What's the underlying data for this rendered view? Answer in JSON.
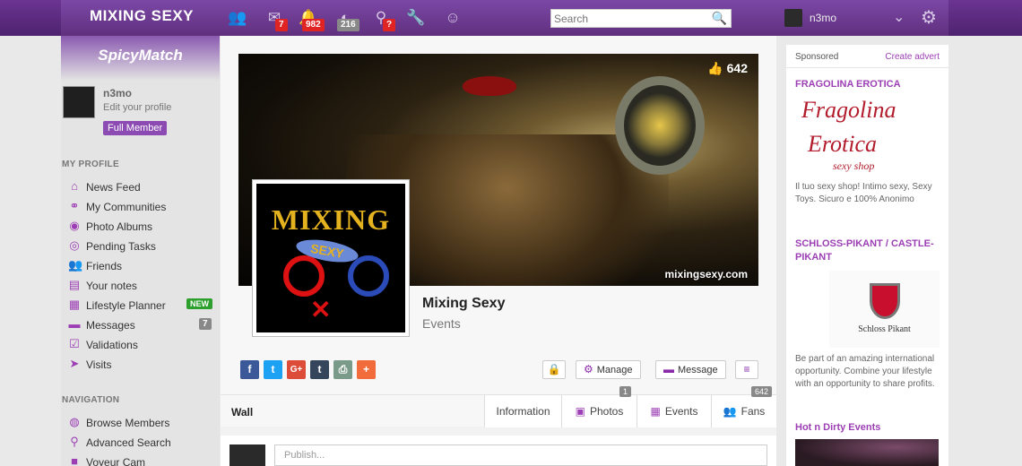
{
  "topbar": {
    "logo": "MIXING SEXY",
    "badges": {
      "messages": "7",
      "notifications": "982",
      "visits": "216",
      "places": "?"
    },
    "search_placeholder": "Search",
    "username": "n3mo"
  },
  "sidebar": {
    "banner": "SpicyMatch",
    "profile": {
      "name": "n3mo",
      "edit": "Edit your profile",
      "membership": "Full Member"
    },
    "my_profile_title": "MY PROFILE",
    "my_profile_items": [
      {
        "label": "News Feed",
        "icon": "home-icon"
      },
      {
        "label": "My Communities",
        "icon": "communities-icon"
      },
      {
        "label": "Photo Albums",
        "icon": "camera-icon"
      },
      {
        "label": "Pending Tasks",
        "icon": "tasks-icon"
      },
      {
        "label": "Friends",
        "icon": "friends-icon"
      },
      {
        "label": "Your notes",
        "icon": "notes-icon"
      },
      {
        "label": "Lifestyle Planner",
        "icon": "calendar-icon",
        "tag": "NEW"
      },
      {
        "label": "Messages",
        "icon": "chat-icon",
        "count": "7"
      },
      {
        "label": "Validations",
        "icon": "check-icon"
      },
      {
        "label": "Visits",
        "icon": "cursor-icon"
      }
    ],
    "navigation_title": "NAVIGATION",
    "navigation_items": [
      {
        "label": "Browse Members",
        "icon": "globe-icon"
      },
      {
        "label": "Advanced Search",
        "icon": "search-icon"
      },
      {
        "label": "Voyeur Cam",
        "icon": "video-icon"
      }
    ]
  },
  "main": {
    "likes": "642",
    "watermark": "mixingsexy.com",
    "group_name": "Mixing Sexy",
    "group_type": "Events",
    "logo_text": "MIXING",
    "logo_badge": "SEXY",
    "actions": {
      "manage": "Manage",
      "message": "Message"
    },
    "tabs": {
      "wall": "Wall",
      "information": "Information",
      "photos": "Photos",
      "photos_count": "1",
      "events": "Events",
      "fans": "Fans",
      "fans_count": "642"
    },
    "publish_placeholder": "Publish..."
  },
  "ads": {
    "sponsored": "Sponsored",
    "create_advert": "Create advert",
    "ad1": {
      "title": "FRAGOLINA EROTICA",
      "logo1": "Fragolina",
      "logo2": "Erotica",
      "logo3": "sexy shop",
      "text": "Il tuo sexy shop! Intimo sexy, Sexy Toys. Sicuro e 100% Anonimo"
    },
    "ad2": {
      "title": "SCHLOSS-PIKANT / CASTLE-PIKANT",
      "logo": "Schloss Pikant",
      "text": "Be part of an amazing international opportunity. Combine your lifestyle with an opportunity to share profits."
    },
    "ad3": {
      "title": "Hot n Dirty Events"
    }
  }
}
